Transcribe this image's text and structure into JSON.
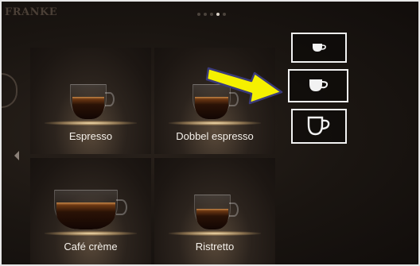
{
  "brand": {
    "name": "FRANKE"
  },
  "pagination": {
    "total": 5,
    "active_index": 3
  },
  "products": [
    {
      "label": "Espresso"
    },
    {
      "label": "Dobbel espresso"
    },
    {
      "label": "Café crème"
    },
    {
      "label": "Ristretto"
    }
  ],
  "cup_sizes": [
    {
      "size": "small"
    },
    {
      "size": "medium"
    },
    {
      "size": "large"
    }
  ],
  "colors": {
    "arrow_fill": "#f5f000",
    "arrow_stroke": "#3a3a7a",
    "button_border": "#f2f2f2"
  }
}
